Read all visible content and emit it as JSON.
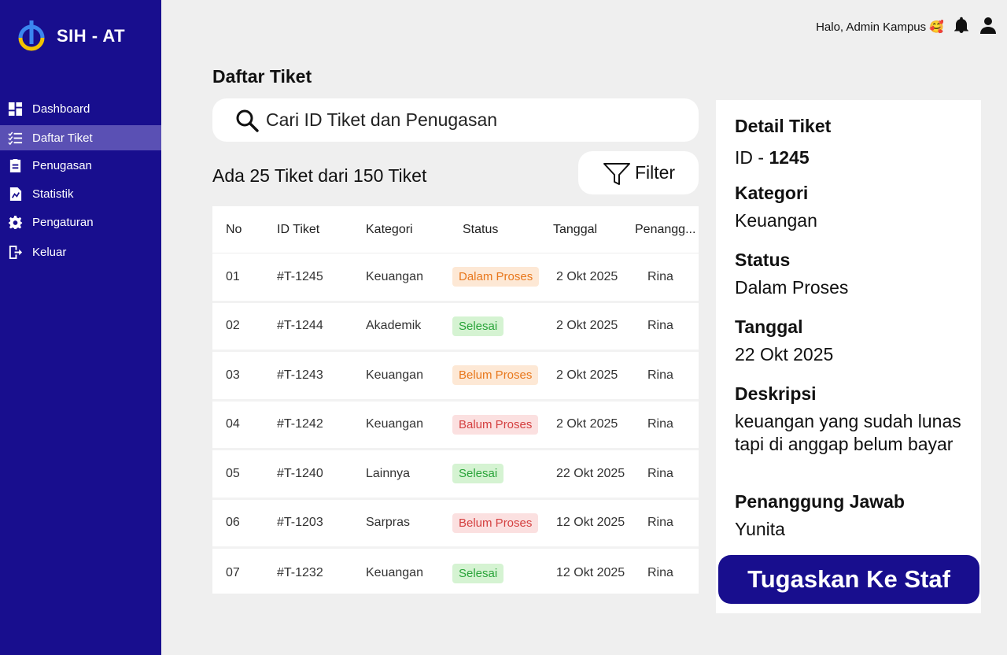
{
  "brand": {
    "name": "SIH - AT"
  },
  "sidebar": {
    "items": [
      {
        "label": "Dashboard",
        "icon": "dashboard-icon",
        "active": false
      },
      {
        "label": "Daftar Tiket",
        "icon": "checklist-icon",
        "active": true
      },
      {
        "label": "Penugasan",
        "icon": "clipboard-icon",
        "active": false
      },
      {
        "label": "Statistik",
        "icon": "chart-file-icon",
        "active": false
      },
      {
        "label": "Pengaturan",
        "icon": "gear-icon",
        "active": false
      },
      {
        "label": "Keluar",
        "icon": "logout-icon",
        "active": false
      }
    ]
  },
  "topbar": {
    "greeting": "Halo, Admin Kampus 🥰"
  },
  "page": {
    "title": "Daftar Tiket"
  },
  "search": {
    "placeholder": "Cari ID Tiket dan Penugasan"
  },
  "summary": {
    "text": "Ada 25 Tiket dari 150 Tiket"
  },
  "filter": {
    "label": "Filter"
  },
  "table": {
    "headers": {
      "no": "No",
      "id": "ID Tiket",
      "kategori": "Kategori",
      "status": "Status",
      "tanggal": "Tanggal",
      "penanggung": "Penangg..."
    },
    "rows": [
      {
        "no": "01",
        "id": "#T-1245",
        "kategori": "Keuangan",
        "status": "Dalam Proses",
        "tanggal": "2 Okt 2025",
        "penanggung": "Rina"
      },
      {
        "no": "02",
        "id": "#T-1244",
        "kategori": "Akademik",
        "status": "Selesai",
        "tanggal": "2 Okt 2025",
        "penanggung": "Rina"
      },
      {
        "no": "03",
        "id": "#T-1243",
        "kategori": "Keuangan",
        "status": "Belum Proses",
        "tanggal": "2 Okt 2025",
        "penanggung": "Rina"
      },
      {
        "no": "04",
        "id": "#T-1242",
        "kategori": "Keuangan",
        "status": "Balum Proses",
        "tanggal": "2 Okt 2025",
        "penanggung": "Rina"
      },
      {
        "no": "05",
        "id": "#T-1240",
        "kategori": "Lainnya",
        "status": "Selesai",
        "tanggal": "22 Okt 2025",
        "penanggung": "Rina"
      },
      {
        "no": "06",
        "id": "#T-1203",
        "kategori": "Sarpras",
        "status": "Belum Proses",
        "tanggal": "12 Okt 2025",
        "penanggung": "Rina"
      },
      {
        "no": "07",
        "id": "#T-1232",
        "kategori": "Keuangan",
        "status": "Selesai",
        "tanggal": "12 Okt 2025",
        "penanggung": "Rina"
      }
    ]
  },
  "detail": {
    "title": "Detail Tiket",
    "id_prefix": "ID - ",
    "id_value": "1245",
    "kategori_label": "Kategori",
    "kategori_value": "Keuangan",
    "status_label": "Status",
    "status_value": "Dalam Proses",
    "tanggal_label": "Tanggal",
    "tanggal_value": "22 Okt 2025",
    "deskripsi_label": "Deskripsi",
    "deskripsi_value": "keuangan yang sudah lunas tapi di anggap belum bayar",
    "penanggung_label": "Penanggung Jawab",
    "penanggung_value": "Yunita",
    "assign_label": "Tugaskan Ke Staf"
  },
  "colors": {
    "sidebar_bg": "#180e8e",
    "sidebar_active": "#5a50b4",
    "page_bg": "#efefef",
    "badge_orange": "#e8771c",
    "badge_green": "#2aa43a",
    "badge_red": "#d44040"
  }
}
